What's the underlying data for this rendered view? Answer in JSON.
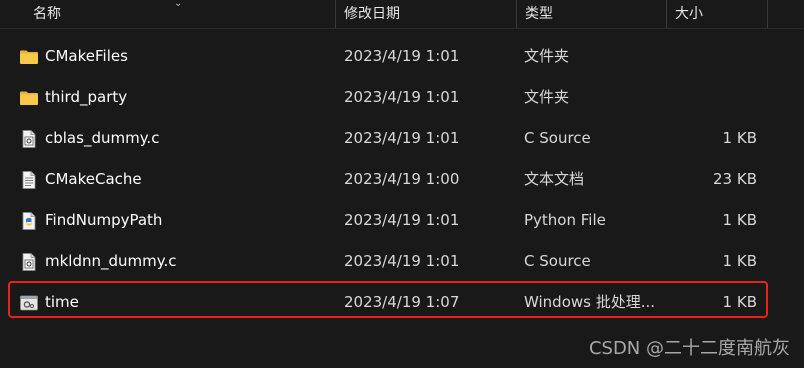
{
  "columns": {
    "name": "名称",
    "date": "修改日期",
    "type": "类型",
    "size": "大小"
  },
  "files": [
    {
      "name": "CMakeFiles",
      "date": "2023/4/19 1:01",
      "type": "文件夹",
      "size": "",
      "icon": "folder-icon"
    },
    {
      "name": "third_party",
      "date": "2023/4/19 1:01",
      "type": "文件夹",
      "size": "",
      "icon": "folder-icon"
    },
    {
      "name": "cblas_dummy.c",
      "date": "2023/4/19 1:01",
      "type": "C Source",
      "size": "1 KB",
      "icon": "c-source-file-icon"
    },
    {
      "name": "CMakeCache",
      "date": "2023/4/19 1:00",
      "type": "文本文档",
      "size": "23 KB",
      "icon": "text-file-icon"
    },
    {
      "name": "FindNumpyPath",
      "date": "2023/4/19 1:01",
      "type": "Python File",
      "size": "1 KB",
      "icon": "python-file-icon"
    },
    {
      "name": "mkldnn_dummy.c",
      "date": "2023/4/19 1:01",
      "type": "C Source",
      "size": "1 KB",
      "icon": "c-source-file-icon"
    },
    {
      "name": "time",
      "date": "2023/4/19 1:07",
      "type": "Windows 批处理...",
      "size": "1 KB",
      "icon": "batch-file-icon"
    }
  ],
  "highlight_color": "#e8231c",
  "watermark": "CSDN @二十二度南航灰"
}
